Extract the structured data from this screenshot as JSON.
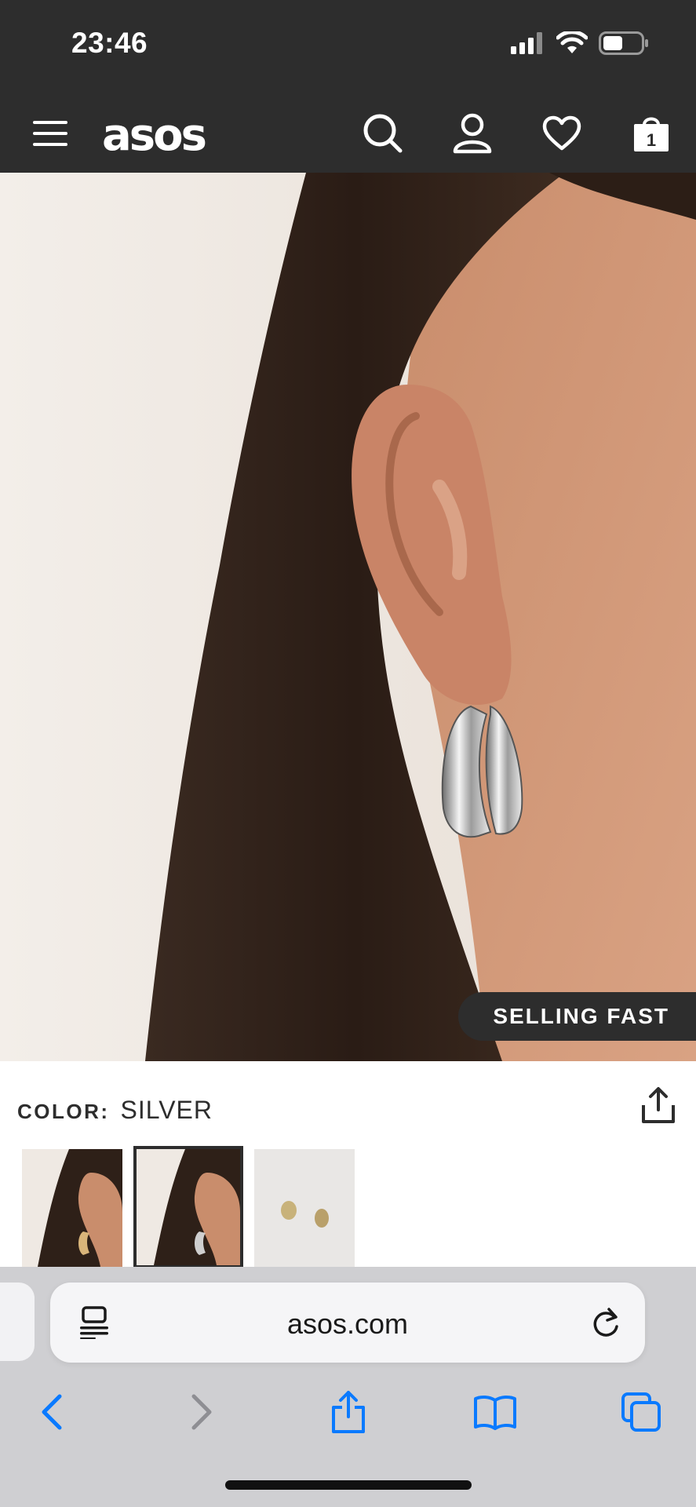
{
  "status_bar": {
    "time": "23:46",
    "icons": [
      "signal-icon",
      "wifi-icon",
      "battery-icon"
    ]
  },
  "header": {
    "logo": "asos",
    "icons": [
      "menu-icon",
      "search-icon",
      "account-icon",
      "heart-icon",
      "bag-icon"
    ],
    "bag_count": "1"
  },
  "product": {
    "carousel_dots": 3,
    "active_dot": 1,
    "badge": "SELLING FAST",
    "color_label": "COLOR:",
    "color_value": "SILVER",
    "thumbnails": 3,
    "selected_thumbnail": 2
  },
  "browser": {
    "url": "asos.com",
    "toolbar_icons": [
      "back-icon",
      "forward-icon",
      "share-icon",
      "bookmarks-icon",
      "tabs-icon"
    ]
  },
  "colors": {
    "header_bg": "#2d2d2d",
    "safari_accent": "#0a7aff",
    "safari_bar_bg": "#cfcfd2"
  }
}
